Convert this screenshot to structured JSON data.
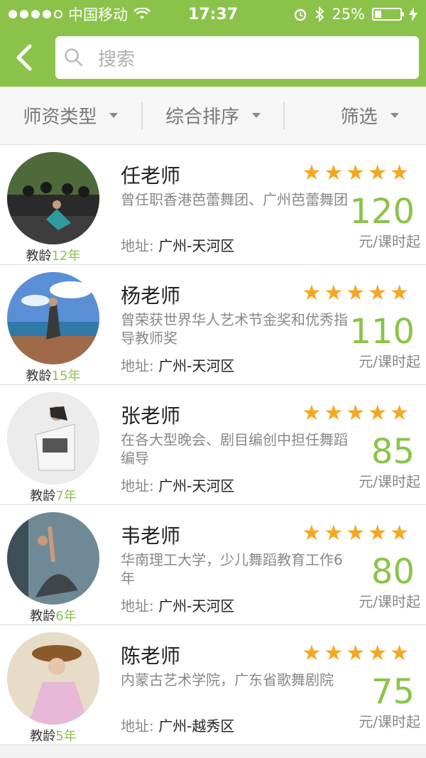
{
  "status_bar": {
    "carrier": "中国移动",
    "time": "17:37",
    "battery": "25%",
    "battery_level": 0.25,
    "signal_dots": [
      true,
      true,
      true,
      true,
      false
    ]
  },
  "nav": {
    "search_placeholder": "搜索"
  },
  "filters": [
    {
      "label": "师资类型"
    },
    {
      "label": "综合排序"
    },
    {
      "label": "筛选"
    }
  ],
  "colors": {
    "accent": "#8bc34a",
    "star": "#f5a623"
  },
  "teachers": [
    {
      "name": "任老师",
      "desc": "曾任职香港芭蕾舞团、广州芭蕾舞团",
      "addr_label": "地址:",
      "addr": "广州-天河区",
      "price": "120",
      "unit": "元/课时起",
      "exp_label": "教龄",
      "exp_years": "12年",
      "rating": 5
    },
    {
      "name": "杨老师",
      "desc": "曾荣获世界华人艺术节金奖和优秀指导教师奖",
      "addr_label": "地址:",
      "addr": "广州-天河区",
      "price": "110",
      "unit": "元/课时起",
      "exp_label": "教龄",
      "exp_years": "15年",
      "rating": 5
    },
    {
      "name": "张老师",
      "desc": "在各大型晚会、剧目编创中担任舞蹈编导",
      "addr_label": "地址:",
      "addr": "广州-天河区",
      "price": "85",
      "unit": "元/课时起",
      "exp_label": "教龄",
      "exp_years": "7年",
      "rating": 5
    },
    {
      "name": "韦老师",
      "desc": "华南理工大学，少儿舞蹈教育工作6年",
      "addr_label": "地址:",
      "addr": "广州-天河区",
      "price": "80",
      "unit": "元/课时起",
      "exp_label": "教龄",
      "exp_years": "6年",
      "rating": 5
    },
    {
      "name": "陈老师",
      "desc": "内蒙古艺术学院，广东省歌舞剧院",
      "addr_label": "地址:",
      "addr": "广州-越秀区",
      "price": "75",
      "unit": "元/课时起",
      "exp_label": "教龄",
      "exp_years": "5年",
      "rating": 5
    }
  ]
}
